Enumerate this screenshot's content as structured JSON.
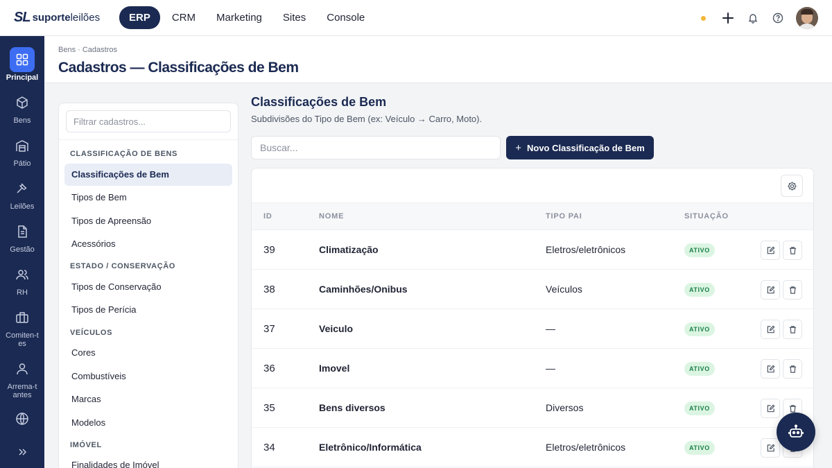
{
  "topbar": {
    "logo_mark": "SL",
    "logo_bold": "suporte",
    "logo_light": "leilões",
    "nav": [
      {
        "label": "ERP",
        "active": true
      },
      {
        "label": "CRM",
        "active": false
      },
      {
        "label": "Marketing",
        "active": false
      },
      {
        "label": "Sites",
        "active": false
      },
      {
        "label": "Console",
        "active": false
      }
    ],
    "status_dot_color": "#f5b73b",
    "icons": [
      "plus-icon",
      "bell-icon",
      "help-icon"
    ]
  },
  "rail": [
    {
      "label": "Principal",
      "icon": "dashboard-icon",
      "active": true
    },
    {
      "label": "Bens",
      "icon": "box-icon"
    },
    {
      "label": "Pátio",
      "icon": "warehouse-icon"
    },
    {
      "label": "Leilões",
      "icon": "gavel-icon"
    },
    {
      "label": "Gestão",
      "icon": "document-icon"
    },
    {
      "label": "RH",
      "icon": "users-icon"
    },
    {
      "label": "Comiten-tes",
      "icon": "briefcase-icon"
    },
    {
      "label": "Arrema-tantes",
      "icon": "user-icon"
    },
    {
      "label": "",
      "icon": "globe-icon"
    },
    {
      "label": "",
      "icon": "chevrons-right-icon"
    }
  ],
  "page": {
    "breadcrumb": "Bens · Cadastros",
    "title": "Cadastros — Classificações de Bem"
  },
  "filter": {
    "placeholder": "Filtrar cadastros...",
    "groups": [
      {
        "title": "CLASSIFICAÇÃO DE BENS",
        "items": [
          "Classificações de Bem",
          "Tipos de Bem",
          "Tipos de Apreensão",
          "Acessórios"
        ]
      },
      {
        "title": "ESTADO / CONSERVAÇÃO",
        "items": [
          "Tipos de Conservação",
          "Tipos de Perícia"
        ]
      },
      {
        "title": "VEÍCULOS",
        "items": [
          "Cores",
          "Combustíveis",
          "Marcas",
          "Modelos"
        ]
      },
      {
        "title": "IMÓVEL",
        "items": [
          "Finalidades de Imóvel"
        ]
      }
    ],
    "active_item": "Classificações de Bem"
  },
  "main": {
    "title": "Classificações de Bem",
    "subtitle": "Subdivisões do Tipo de Bem (ex: Veículo → Carro, Moto).",
    "search_placeholder": "Buscar...",
    "new_button": "Novo Classificação de Bem",
    "columns": [
      "ID",
      "NOME",
      "TIPO PAI",
      "SITUAÇÃO"
    ],
    "rows": [
      {
        "id": "39",
        "nome": "Climatização",
        "pai": "Eletros/eletrônicos",
        "status": "ATIVO"
      },
      {
        "id": "38",
        "nome": "Caminhões/Onibus",
        "pai": "Veículos",
        "status": "ATIVO"
      },
      {
        "id": "37",
        "nome": "Veiculo",
        "pai": "—",
        "status": "ATIVO"
      },
      {
        "id": "36",
        "nome": "Imovel",
        "pai": "—",
        "status": "ATIVO"
      },
      {
        "id": "35",
        "nome": "Bens diversos",
        "pai": "Diversos",
        "status": "ATIVO"
      },
      {
        "id": "34",
        "nome": "Eletrônico/Informática",
        "pai": "Eletros/eletrônicos",
        "status": "ATIVO"
      }
    ]
  },
  "colors": {
    "navy": "#1b2a52",
    "accent": "#3d6df2",
    "badge_bg": "#dcf5e3",
    "badge_fg": "#198046"
  }
}
